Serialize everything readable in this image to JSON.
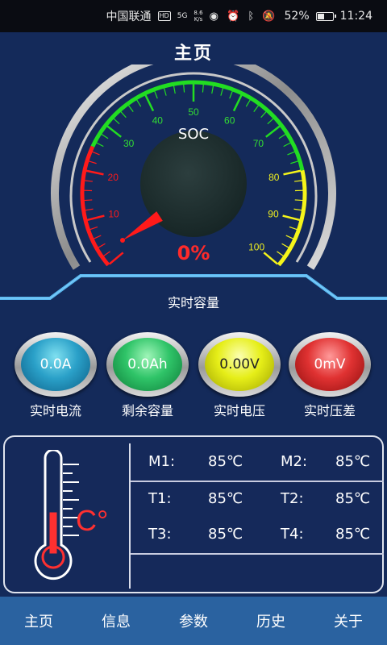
{
  "status_bar": {
    "carrier": "中国联通",
    "hd_badge": "HD",
    "network": "5G",
    "speed_value": "8.6",
    "speed_unit": "K/s",
    "icons": [
      "eye-icon",
      "alarm-icon",
      "bluetooth-icon",
      "mute-icon"
    ],
    "battery_percent": "52%",
    "battery_level": 0.52,
    "time": "11:24"
  },
  "header": {
    "title": "主页"
  },
  "gauge": {
    "label": "SOC",
    "value_text": "0%",
    "value": 0,
    "min": 0,
    "max": 100,
    "ticks": [
      "10",
      "20",
      "30",
      "40",
      "50",
      "60",
      "70",
      "80",
      "90",
      "100"
    ],
    "colors": {
      "red": "#ff1a1a",
      "green": "#22dd22",
      "yellow": "#f5f51a",
      "green_text": "#33dd33",
      "yellow_text": "#f0f020"
    }
  },
  "capacity": {
    "title": "实时容量"
  },
  "meters": [
    {
      "value": "0.0A",
      "label": "实时电流",
      "color": "blue"
    },
    {
      "value": "0.0Ah",
      "label": "剩余容量",
      "color": "green"
    },
    {
      "value": "0.00V",
      "label": "实时电压",
      "color": "yellow"
    },
    {
      "value": "0mV",
      "label": "实时压差",
      "color": "red"
    }
  ],
  "temperature": {
    "unit_symbol": "C°",
    "rows": [
      {
        "a_label": "M1:",
        "a_value": "85℃",
        "b_label": "M2:",
        "b_value": "85℃"
      },
      {
        "a_label": "T1:",
        "a_value": "85℃",
        "b_label": "T2:",
        "b_value": "85℃"
      },
      {
        "a_label": "T3:",
        "a_value": "85℃",
        "b_label": "T4:",
        "b_value": "85℃"
      }
    ]
  },
  "tabs": [
    "主页",
    "信息",
    "参数",
    "历史",
    "关于"
  ]
}
